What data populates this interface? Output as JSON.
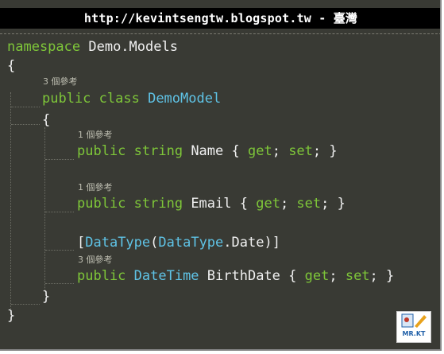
{
  "banner": {
    "text": "http://kevintsengtw.blogspot.tw - 臺灣"
  },
  "code": {
    "l1_kw": "namespace",
    "l1_name": " Demo.Models",
    "l2_brace": "{",
    "r1": "3 個參考",
    "l4_public": "public",
    "l4_class": " class ",
    "l4_type": "DemoModel",
    "l5_brace": "{",
    "r2": "1 個參考",
    "l7_public": "public",
    "l7_type": " string",
    "l7_name": " Name ",
    "l7_open": "{ ",
    "l7_get": "get",
    "l7_semi1": "; ",
    "l7_set": "set",
    "l7_close": "; }",
    "r3": "1 個參考",
    "l9_public": "public",
    "l9_type": " string",
    "l9_name": " Email ",
    "l9_open": "{ ",
    "l9_get": "get",
    "l9_semi1": "; ",
    "l9_set": "set",
    "l9_close": "; }",
    "l11_open": "[",
    "l11_attr": "DataType",
    "l11_paren": "(",
    "l11_enum": "DataType",
    "l11_member": ".Date)]",
    "r4": "3 個參考",
    "l13_public": "public",
    "l13_type": " DateTime",
    "l13_name": " BirthDate ",
    "l13_open": "{ ",
    "l13_get": "get",
    "l13_semi1": "; ",
    "l13_set": "set",
    "l13_close": "; }",
    "l14_brace": "}",
    "l15_brace": "}"
  },
  "logo": {
    "text": "MR.KT"
  },
  "colors": {
    "background": "#393a34",
    "keyword": "#7ec639",
    "type": "#5fc3e6",
    "text": "#f0f0f0",
    "reference": "#bdbdb0"
  }
}
